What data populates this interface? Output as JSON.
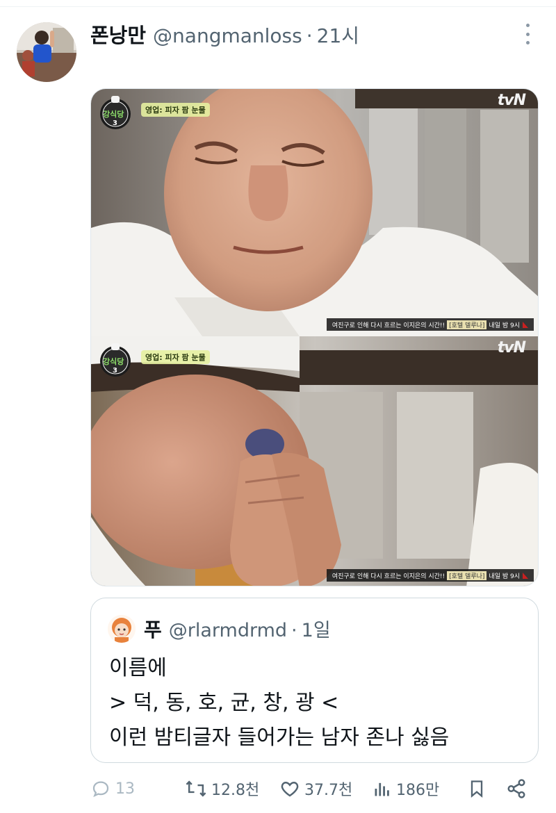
{
  "tweet": {
    "display_name": "폰낭만",
    "handle": "@nangmanloss",
    "separator": "·",
    "time": "21시"
  },
  "media": {
    "frames": [
      {
        "logo_text": "강식당",
        "logo_num": "3",
        "caption": "영업: 피자 팜 눈물",
        "broadcaster": "tvN",
        "ticker_before": "여진구로 인해 다시 흐르는 이지은의 시간!! ",
        "ticker_highlight": "[호텔 델루나]",
        "ticker_after": " 내일 밤 9시"
      },
      {
        "logo_text": "강식당",
        "logo_num": "3",
        "caption": "영업: 피자 팜 눈물",
        "broadcaster": "tvN",
        "ticker_before": "여진구로 인해 다시 흐르는 이지은의 시간!! ",
        "ticker_highlight": "[호텔 델루나]",
        "ticker_after": " 내일 밤 9시"
      }
    ]
  },
  "quote": {
    "display_name": "푸",
    "handle": "@rlarmdrmd",
    "separator": "·",
    "time": "1일",
    "lines": [
      "이름에",
      "> 덕, 동, 호, 균, 창, 광 <",
      "이런 밤티글자 들어가는 남자 존나 싫음"
    ]
  },
  "actions": {
    "reply_count": "13",
    "retweet_count": "12.8천",
    "like_count": "37.7천",
    "view_count": "186만"
  },
  "icons": {
    "reply": "reply-icon",
    "retweet": "retweet-icon",
    "like": "heart-icon",
    "views": "views-icon",
    "bookmark": "bookmark-icon",
    "share": "share-icon",
    "more": "more-icon"
  },
  "colors": {
    "text": "#0f1419",
    "secondary": "#536471",
    "border": "#cfd9de",
    "ticker_flag": "#c82020"
  }
}
